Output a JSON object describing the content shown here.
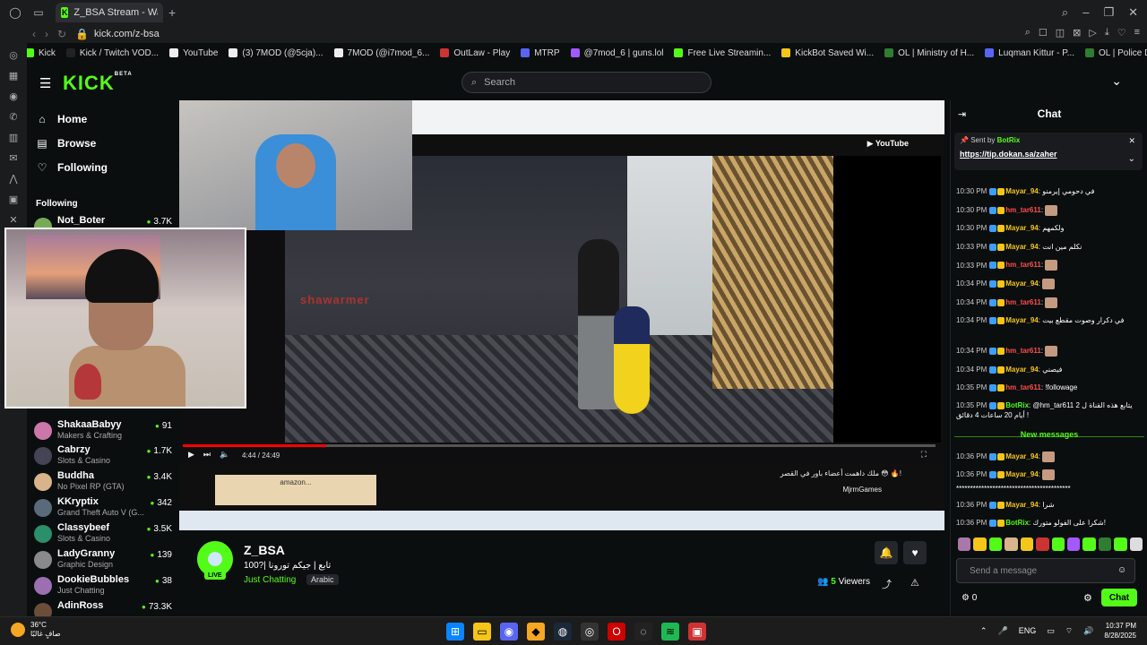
{
  "browser": {
    "tab_title": "Z_BSA Stream - Watch Li...",
    "url": "kick.com/z-bsa",
    "bookmarks": [
      {
        "label": "Kick",
        "color": "#53fc18"
      },
      {
        "label": "Kick / Twitch VOD...",
        "color": "#222"
      },
      {
        "label": "YouTube",
        "color": "#eee"
      },
      {
        "label": "(3) 7MOD (@5cja)...",
        "color": "#eee"
      },
      {
        "label": "7MOD (@i7mod_6...",
        "color": "#eee"
      },
      {
        "label": "OutLaw - Play",
        "color": "#c33"
      },
      {
        "label": "MTRP",
        "color": "#5865f2"
      },
      {
        "label": "@7mod_6 | guns.lol",
        "color": "#a259ff"
      },
      {
        "label": "Free Live Streamin...",
        "color": "#53fc18"
      },
      {
        "label": "KickBot Saved Wi...",
        "color": "#f5c518"
      },
      {
        "label": "OL | Ministry of H...",
        "color": "#2e7d32"
      },
      {
        "label": "Luqman Kittur - P...",
        "color": "#5865f2"
      },
      {
        "label": "OL | Police Depart...",
        "color": "#2e7d32"
      }
    ]
  },
  "header": {
    "logo": "KICK",
    "logo_sup": "BETA",
    "search_placeholder": "Search"
  },
  "sidebar": {
    "nav": [
      {
        "label": "Home",
        "icon": "home-icon",
        "glyph": "⌂"
      },
      {
        "label": "Browse",
        "icon": "browse-icon",
        "glyph": "▤"
      },
      {
        "label": "Following",
        "icon": "heart-icon",
        "glyph": "♡"
      }
    ],
    "following_heading": "Following",
    "following": [
      {
        "name": "Not_Boter",
        "category": "",
        "viewers": "3.7K",
        "color": "#7a5"
      },
      {
        "name": "ShakaaBabyy",
        "category": "Makers & Crafting",
        "viewers": "91",
        "color": "#c7a"
      },
      {
        "name": "Cabrzy",
        "category": "Slots & Casino",
        "viewers": "1.7K",
        "color": "#445"
      },
      {
        "name": "Buddha",
        "category": "No Pixel RP (GTA)",
        "viewers": "3.4K",
        "color": "#d9b48a"
      },
      {
        "name": "KKryptix",
        "category": "Grand Theft Auto V (G...",
        "viewers": "342",
        "color": "#5a6a7a"
      },
      {
        "name": "Classybeef",
        "category": "Slots & Casino",
        "viewers": "3.5K",
        "color": "#2a8f6a"
      },
      {
        "name": "LadyGranny",
        "category": "Graphic Design",
        "viewers": "139",
        "color": "#8a8a8a"
      },
      {
        "name": "DookieBubbles",
        "category": "Just Chatting",
        "viewers": "38",
        "color": "#9b6fb0"
      },
      {
        "name": "AdinRoss",
        "category": "",
        "viewers": "73.3K",
        "color": "#6a4e3a"
      }
    ]
  },
  "video": {
    "time": "4:44 / 24:49",
    "progress": 0.19,
    "yt_title": "ملك داهمت أعضاء باور في القصر 😳 🔥!",
    "channel": "MjrmGames",
    "ad_text": "amazon...",
    "sign": "shawarmer"
  },
  "stream": {
    "streamer": "Z_BSA",
    "live": "LIVE",
    "title": "100?| تابع | جيكم تورونا",
    "category": "Just Chatting",
    "language": "Arabic",
    "viewers_count": "5",
    "viewers_label": "Viewers"
  },
  "chat": {
    "title": "Chat",
    "pinned_sent_by": "Sent by",
    "pinned_user": "BotRix",
    "pinned_link": "https://tip.dokan.sa/zaher",
    "messages": [
      {
        "time": "10:30 PM",
        "user": "Mayar_94",
        "text": "في دحومي إيرمنو",
        "ucls": "u1"
      },
      {
        "time": "10:30 PM",
        "user": "hm_tar611",
        "text": "",
        "ucls": "u2"
      },
      {
        "time": "10:30 PM",
        "user": "Mayar_94",
        "text": "ولكمهم",
        "ucls": "u1"
      },
      {
        "time": "10:33 PM",
        "user": "Mayar_94",
        "text": "نكلم مين انت",
        "ucls": "u1"
      },
      {
        "time": "10:33 PM",
        "user": "hm_tar611",
        "text": "",
        "ucls": "u2"
      },
      {
        "time": "10:34 PM",
        "user": "Mayar_94",
        "text": "",
        "ucls": "u1"
      },
      {
        "time": "10:34 PM",
        "user": "hm_tar611",
        "text": "",
        "ucls": "u2"
      },
      {
        "time": "10:34 PM",
        "user": "Mayar_94",
        "text": "في دكرار وصوت مقطع بيت",
        "ucls": "u1"
      },
      {
        "time": "10:34 PM",
        "user": "hm_tar611",
        "text": "",
        "ucls": "u2"
      },
      {
        "time": "10:34 PM",
        "user": "Mayar_94",
        "text": "فيصني",
        "ucls": "u1"
      },
      {
        "time": "10:35 PM",
        "user": "hm_tar611",
        "text": "!followage",
        "ucls": "u2"
      },
      {
        "time": "10:35 PM",
        "user": "BotRix",
        "text": "@hm_tar611 يتابع هذه القناة ل 2 أيام 20 ساعات 4 دقائق !",
        "ucls": "u3"
      }
    ],
    "new_messages_label": "New messages",
    "new_messages": [
      {
        "time": "10:36 PM",
        "user": "Mayar_94",
        "text": "",
        "ucls": "u1"
      },
      {
        "time": "10:36 PM",
        "user": "Mayar_94",
        "text": "",
        "ucls": "u1"
      },
      {
        "time": "",
        "user": "",
        "text": "*****************************************",
        "ucls": "u1"
      },
      {
        "time": "10:36 PM",
        "user": "Mayar_94",
        "text": "شرا",
        "ucls": "u1"
      },
      {
        "time": "10:36 PM",
        "user": "BotRix",
        "text": "شكرا على الفولو متورك!",
        "ucls": "u3"
      }
    ],
    "input_placeholder": "Send a message",
    "points": "0",
    "send_label": "Chat"
  },
  "os": {
    "temp": "36°C",
    "weather_text": "صافٍ غالبًا",
    "lang": "ENG",
    "time": "10:37 PM",
    "date": "8/28/2025"
  }
}
